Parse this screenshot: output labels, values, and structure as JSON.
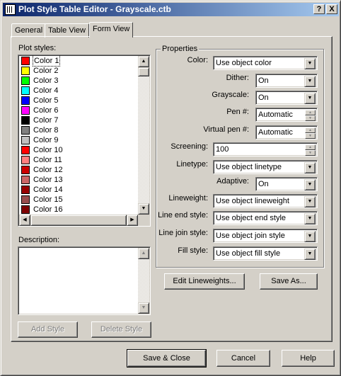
{
  "window": {
    "title": "Plot Style Table Editor - Grayscale.ctb",
    "help_button": "?",
    "close_button": "X"
  },
  "tabs": [
    {
      "label": "General",
      "active": false
    },
    {
      "label": "Table View",
      "active": false
    },
    {
      "label": "Form View",
      "active": true
    }
  ],
  "plot_styles": {
    "label": "Plot styles:",
    "items": [
      {
        "name": "Color 1",
        "color": "#ff0000",
        "selected": true
      },
      {
        "name": "Color 2",
        "color": "#ffff00"
      },
      {
        "name": "Color 3",
        "color": "#00ff00"
      },
      {
        "name": "Color 4",
        "color": "#00ffff"
      },
      {
        "name": "Color 5",
        "color": "#0000ff"
      },
      {
        "name": "Color 6",
        "color": "#ff00ff"
      },
      {
        "name": "Color 7",
        "color": "#000000"
      },
      {
        "name": "Color 8",
        "color": "#808080"
      },
      {
        "name": "Color 9",
        "color": "#c0c0c0"
      },
      {
        "name": "Color 10",
        "color": "#ff0000"
      },
      {
        "name": "Color 11",
        "color": "#ff7f7f"
      },
      {
        "name": "Color 12",
        "color": "#cc0000"
      },
      {
        "name": "Color 13",
        "color": "#cc6666"
      },
      {
        "name": "Color 14",
        "color": "#990000"
      },
      {
        "name": "Color 15",
        "color": "#994c4c"
      },
      {
        "name": "Color 16",
        "color": "#7f0000"
      }
    ]
  },
  "description": {
    "label": "Description:",
    "value": ""
  },
  "buttons": {
    "add_style": "Add Style",
    "delete_style": "Delete Style",
    "edit_lineweights": "Edit Lineweights...",
    "save_as": "Save As...",
    "save_close": "Save & Close",
    "cancel": "Cancel",
    "help": "Help"
  },
  "properties": {
    "title": "Properties",
    "color": {
      "label": "Color:",
      "value": "Use object color"
    },
    "dither": {
      "label": "Dither:",
      "value": "On"
    },
    "grayscale": {
      "label": "Grayscale:",
      "value": "On"
    },
    "pen": {
      "label": "Pen #:",
      "value": "Automatic"
    },
    "virtual_pen": {
      "label": "Virtual pen #:",
      "value": "Automatic"
    },
    "screening": {
      "label": "Screening:",
      "value": "100"
    },
    "linetype": {
      "label": "Linetype:",
      "value": "Use object linetype"
    },
    "adaptive": {
      "label": "Adaptive:",
      "value": "On"
    },
    "lineweight": {
      "label": "Lineweight:",
      "value": "Use object lineweight"
    },
    "line_end_style": {
      "label": "Line end style:",
      "value": "Use object end style"
    },
    "line_join_style": {
      "label": "Line join style:",
      "value": "Use object join style"
    },
    "fill_style": {
      "label": "Fill style:",
      "value": "Use object fill style"
    }
  }
}
